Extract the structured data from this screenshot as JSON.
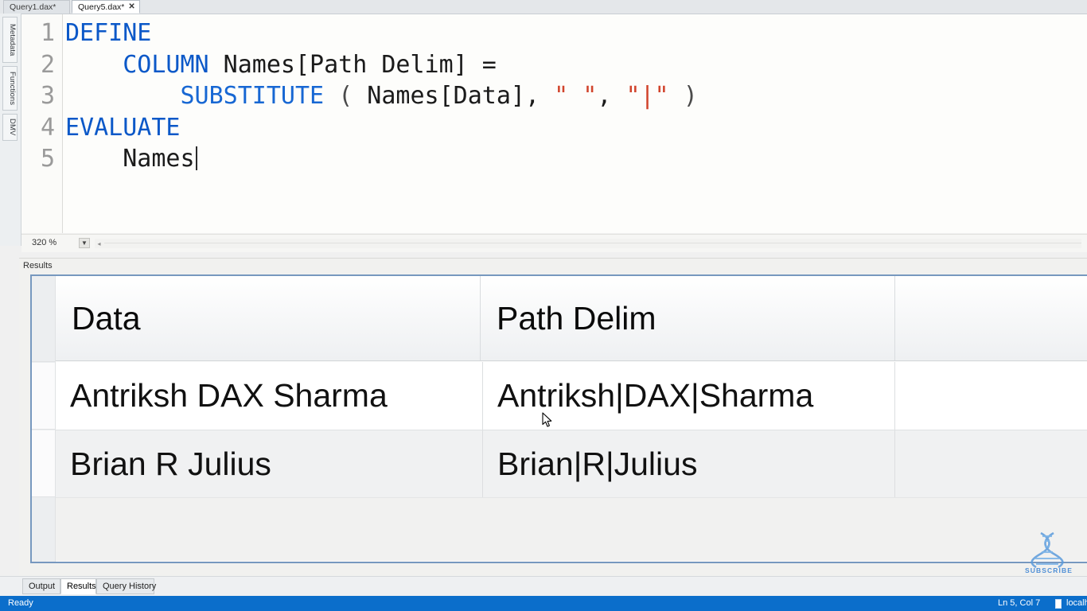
{
  "window": {
    "doc_tabs": [
      {
        "label": "Query1.dax*",
        "active": false,
        "closable": false
      },
      {
        "label": "Query5.dax*",
        "active": true,
        "closable": true,
        "close_glyph": "✕"
      }
    ]
  },
  "side_tabs": [
    {
      "label": "Metadata"
    },
    {
      "label": "Functions"
    },
    {
      "label": "DMV"
    }
  ],
  "editor": {
    "line_numbers": [
      "1",
      "2",
      "3",
      "4",
      "5"
    ],
    "lines": [
      {
        "n": "1",
        "tokens": [
          {
            "t": "DEFINE",
            "c": "kw"
          }
        ]
      },
      {
        "n": "2",
        "tokens": [
          {
            "t": "    ",
            "c": "plain"
          },
          {
            "t": "COLUMN",
            "c": "kw"
          },
          {
            "t": " Names[Path Delim] =",
            "c": "plain"
          }
        ]
      },
      {
        "n": "3",
        "tokens": [
          {
            "t": "        ",
            "c": "plain"
          },
          {
            "t": "SUBSTITUTE",
            "c": "fn"
          },
          {
            "t": " ",
            "c": "plain"
          },
          {
            "t": "(",
            "c": "punct"
          },
          {
            "t": " Names[Data], ",
            "c": "plain"
          },
          {
            "t": "\" \"",
            "c": "str"
          },
          {
            "t": ", ",
            "c": "plain"
          },
          {
            "t": "\"|\"",
            "c": "str"
          },
          {
            "t": " ",
            "c": "plain"
          },
          {
            "t": ")",
            "c": "punct"
          }
        ]
      },
      {
        "n": "4",
        "tokens": [
          {
            "t": "EVALUATE",
            "c": "kw"
          }
        ]
      },
      {
        "n": "5",
        "tokens": [
          {
            "t": "    Names",
            "c": "plain"
          }
        ]
      }
    ],
    "plain_text": "DEFINE\n    COLUMN Names[Path Delim] =\n        SUBSTITUTE ( Names[Data], \" \", \"|\" )\nEVALUATE\n    Names"
  },
  "zoombar": {
    "zoom_level": "320 %",
    "dropdown_glyph": "▼",
    "scroll_left_glyph": "◂"
  },
  "results": {
    "pane_title": "Results",
    "columns": [
      "Data",
      "Path Delim",
      ""
    ],
    "rows": [
      {
        "cells": [
          "Antriksh DAX Sharma",
          "Antriksh|DAX|Sharma",
          ""
        ]
      },
      {
        "cells": [
          "Brian R Julius",
          "Brian|R|Julius",
          ""
        ]
      }
    ]
  },
  "bottom_tabs": [
    {
      "label": "Output",
      "active": false
    },
    {
      "label": "Results",
      "active": true
    },
    {
      "label": "Query History",
      "active": false
    }
  ],
  "statusbar": {
    "status": "Ready",
    "cursor_position": "Ln 5, Col 7",
    "server": "localho"
  },
  "watermark": {
    "label": "SUBSCRIBE"
  },
  "colors": {
    "keyword_blue": "#0b58c8",
    "function_blue": "#1767d3",
    "string_red": "#d1442c",
    "grid_border": "#7798bf",
    "statusbar_blue": "#0b6ecb",
    "watermark_blue": "#4f8fd6"
  }
}
